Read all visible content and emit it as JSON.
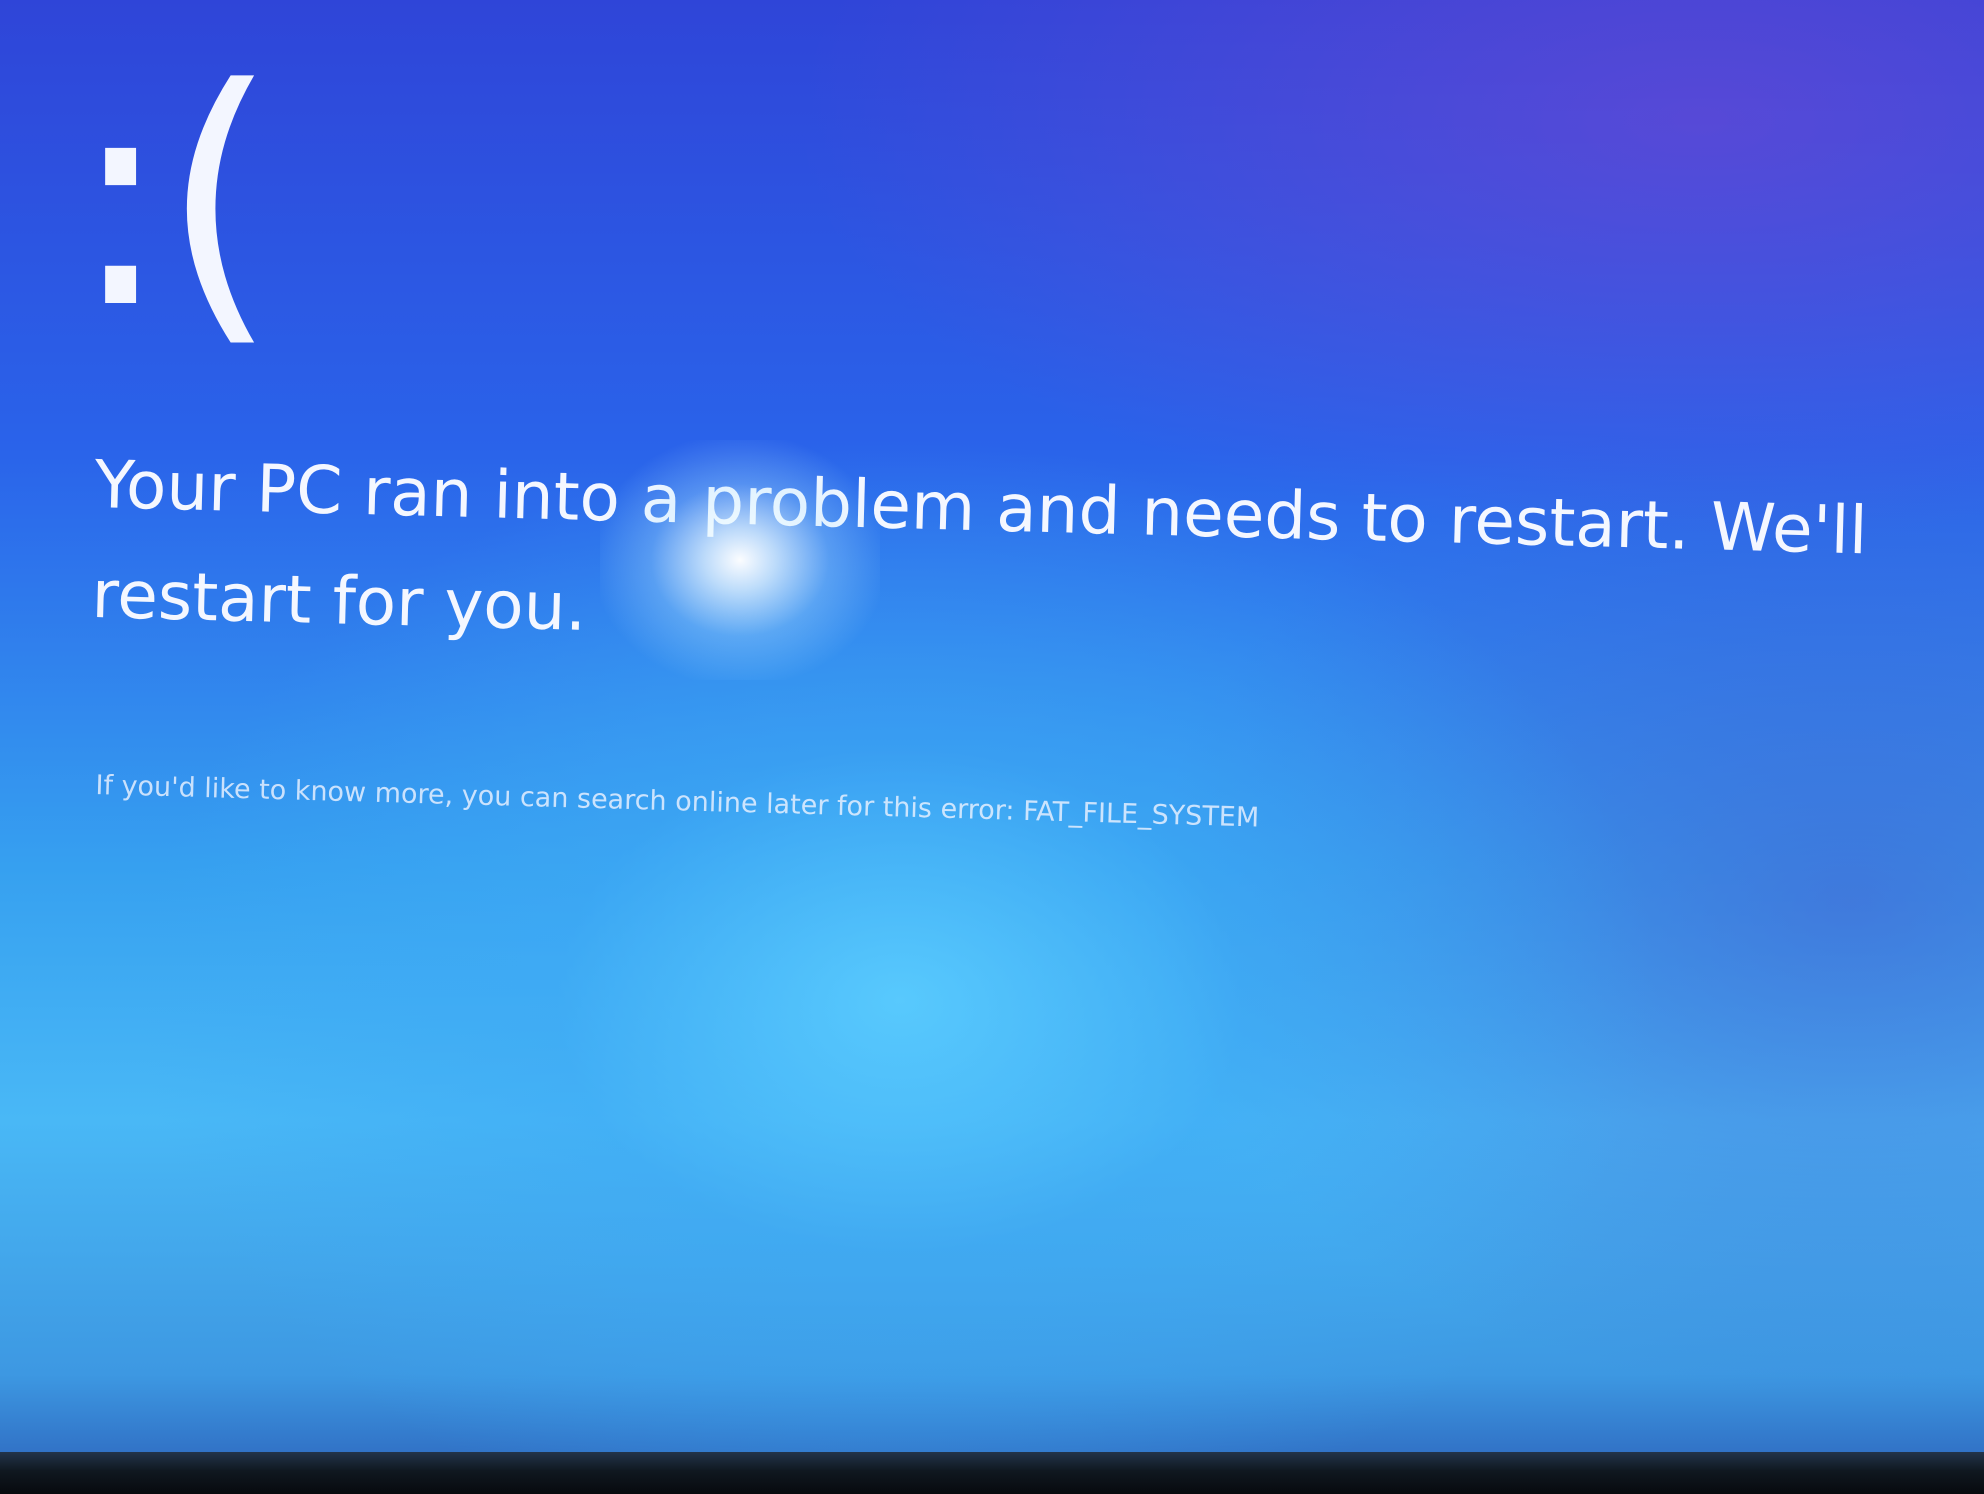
{
  "screen": {
    "type": "stop-error",
    "background_color": "#2f6fe6",
    "text_color": "#f4f7ff"
  },
  "sad_face": {
    "text": ":("
  },
  "message": {
    "text": "Your PC ran into a problem and needs to restart. We'll restart for you."
  },
  "more_info": {
    "text": "If you'd like to know more, you can search online later for this error: FAT_FILE_SYSTEM"
  }
}
